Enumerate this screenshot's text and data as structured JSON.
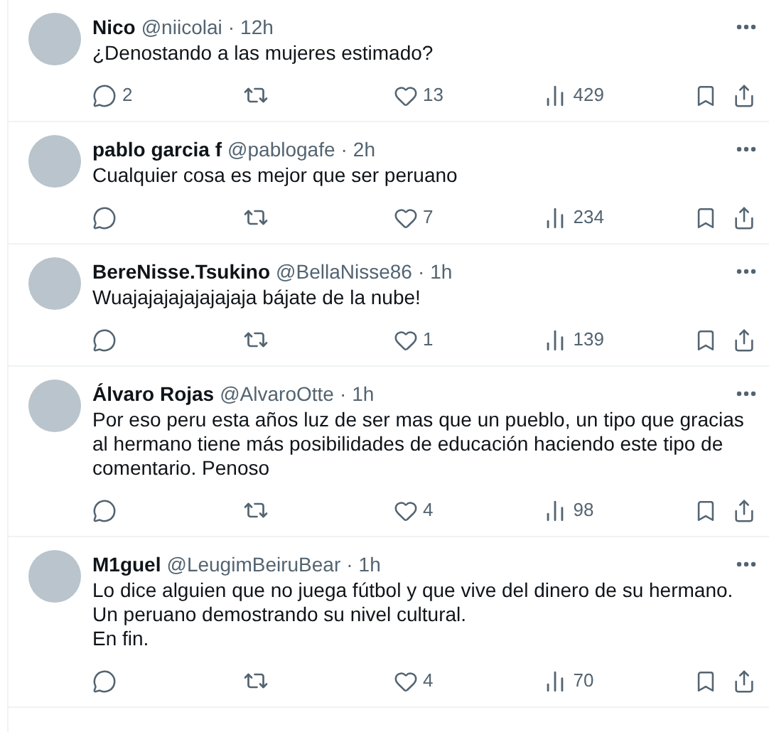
{
  "tweets": [
    {
      "name": "Nico",
      "handle": "@niicolai",
      "separator": "·",
      "time": "12h",
      "text": "¿Denostando a las mujeres estimado?",
      "replies": "2",
      "likes": "13",
      "views": "429"
    },
    {
      "name": "pablo garcia f",
      "handle": "@pablogafe",
      "separator": "·",
      "time": "2h",
      "text": "Cualquier cosa es mejor que ser peruano",
      "likes": "7",
      "views": "234"
    },
    {
      "name": "BereNisse.Tsukino",
      "handle": "@BellaNisse86",
      "separator": "·",
      "time": "1h",
      "text": "Wuajajajajajajajaja bájate de la nube!",
      "likes": "1",
      "views": "139"
    },
    {
      "name": "Álvaro Rojas",
      "handle": "@AlvaroOtte",
      "separator": "·",
      "time": "1h",
      "text": "Por eso peru esta años luz de ser mas que un pueblo, un tipo que gracias al hermano tiene más posibilidades de educación haciendo este tipo de comentario. Penoso",
      "likes": "4",
      "views": "98"
    },
    {
      "name": "M1guel",
      "handle": "@LeugimBeiruBear",
      "separator": "·",
      "time": "1h",
      "text": "Lo dice alguien que no juega fútbol y que vive del dinero de su hermano.\nUn peruano demostrando su nivel cultural.\nEn fin.",
      "likes": "4",
      "views": "70"
    }
  ]
}
